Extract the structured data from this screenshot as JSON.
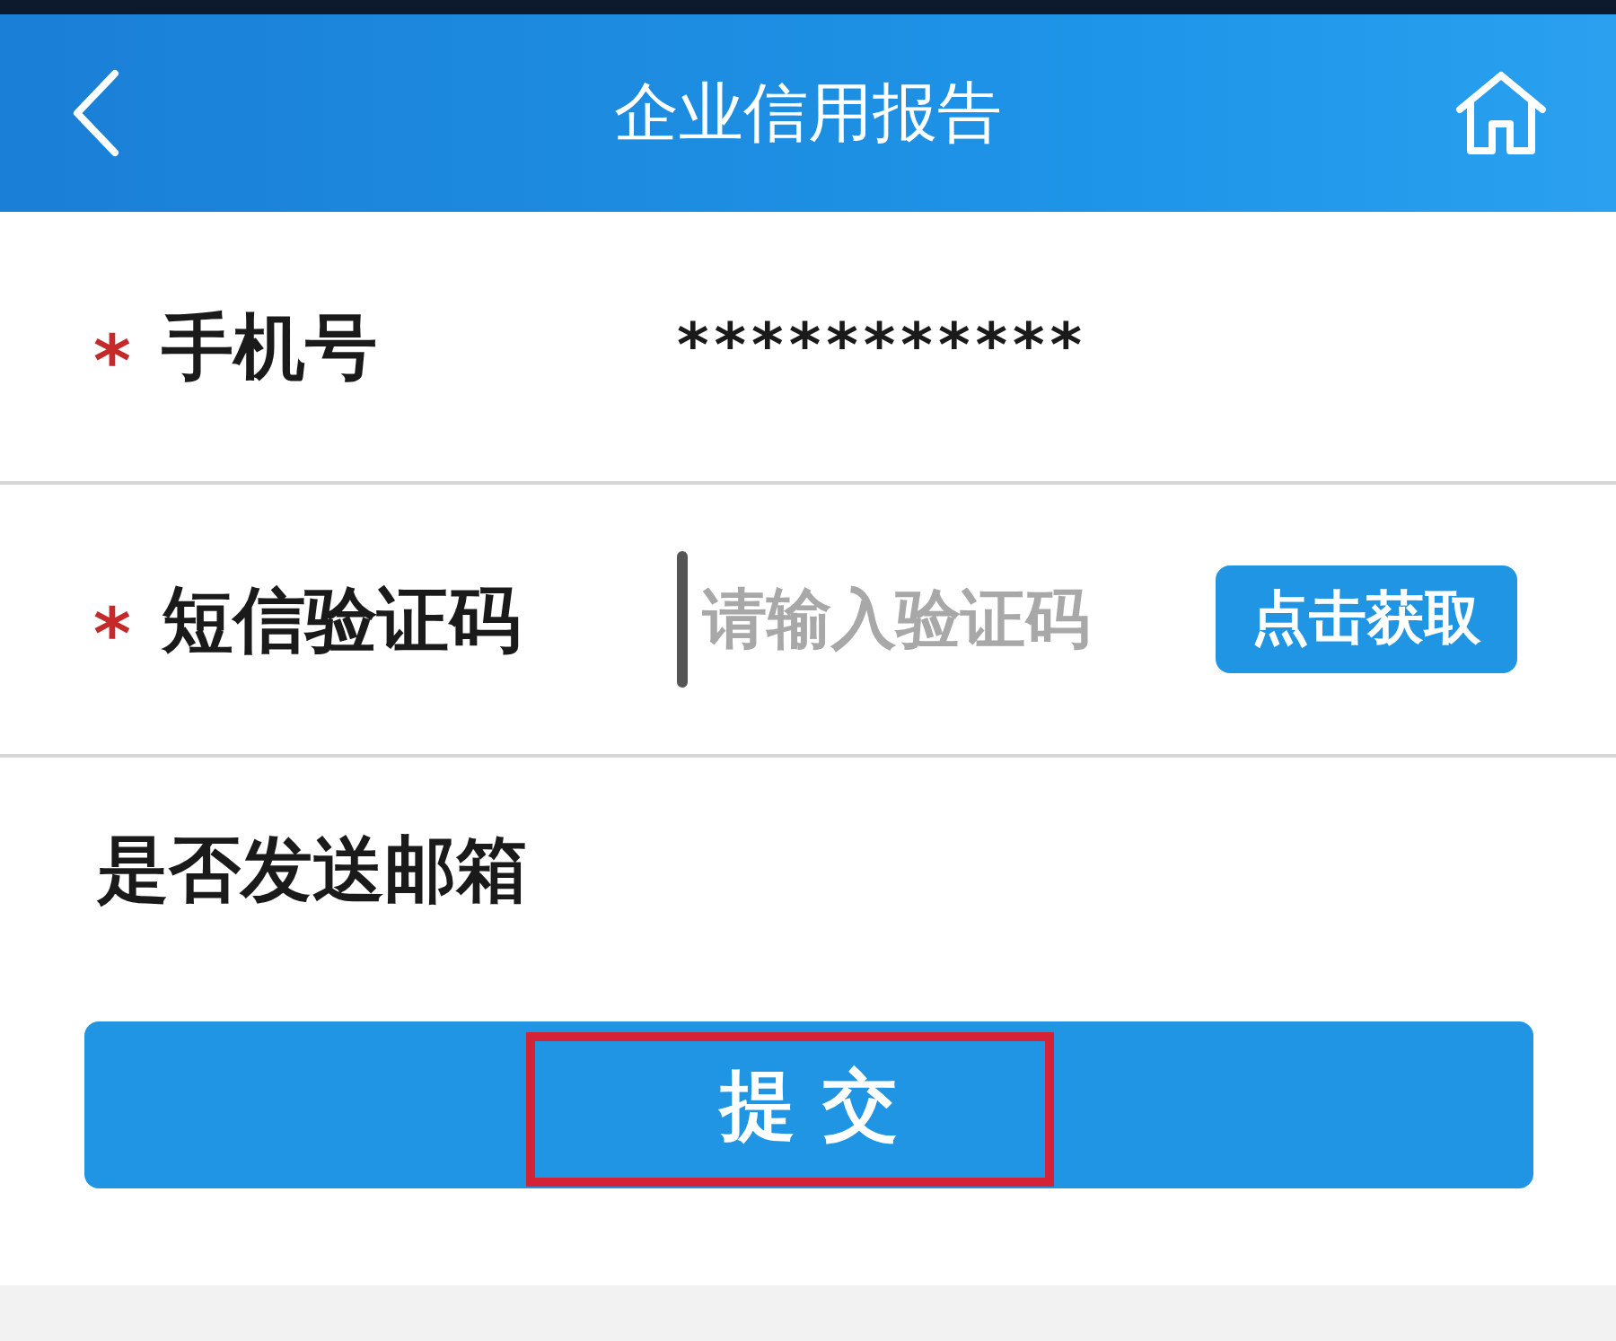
{
  "header": {
    "title": "企业信用报告"
  },
  "fields": [
    {
      "label": "手机号",
      "required_mark": "*",
      "kind": "text",
      "value": "***********"
    },
    {
      "label": "短信验证码",
      "required_mark": "*",
      "kind": "code",
      "placeholder": "请输入验证码",
      "button": "点击获取"
    },
    {
      "label": "是否发送邮箱",
      "kind": "plain"
    }
  ],
  "submit": {
    "label": "提 交",
    "highlighted": true
  }
}
